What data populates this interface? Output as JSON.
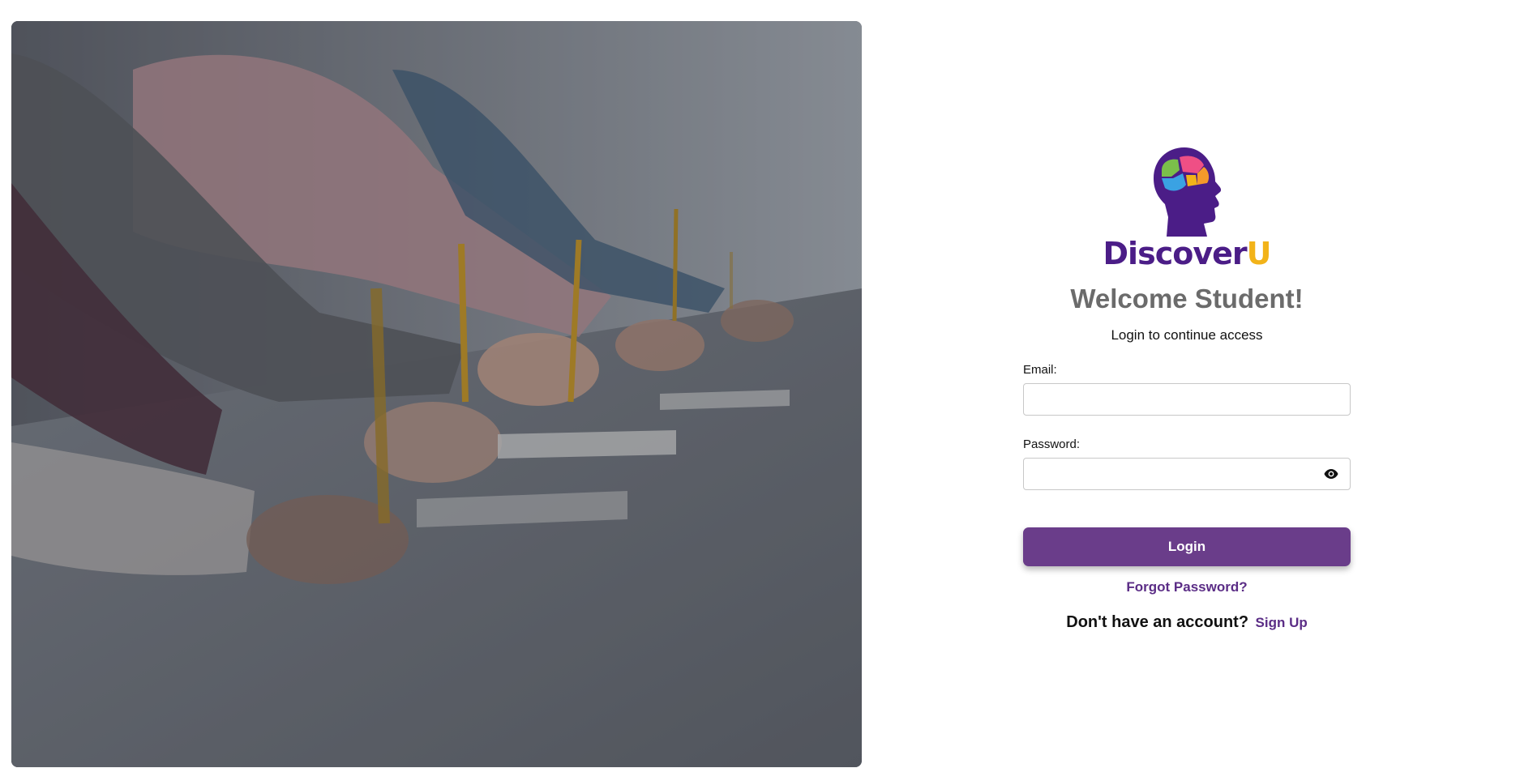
{
  "hero": {
    "image_alt": "Students writing with pencils at a desk"
  },
  "brand": {
    "name_main": "Discover",
    "name_accent": "U",
    "logo_icon": "brain-head-icon",
    "colors": {
      "purple": "#4b1d87",
      "yellow": "#f2b319",
      "button": "#6a3d8a",
      "link": "#5b2d86"
    }
  },
  "login": {
    "title": "Welcome Student!",
    "subtitle": "Login to continue access",
    "email_label": "Email:",
    "email_value": "",
    "password_label": "Password:",
    "password_value": "",
    "password_toggle_icon": "eye-icon",
    "submit_label": "Login",
    "forgot_label": "Forgot Password?",
    "signup_prompt": "Don't have an account?",
    "signup_label": "Sign Up"
  }
}
